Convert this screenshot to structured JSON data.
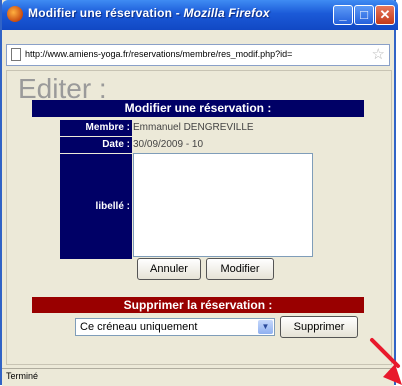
{
  "window": {
    "title_main": "Modifier une réservation - ",
    "title_app": "Mozilla Firefox",
    "min_glyph": "_",
    "max_glyph": "□",
    "close_glyph": "✕"
  },
  "address_bar": {
    "url": "http://www.amiens-yoga.fr/reservations/membre/res_modif.php?id="
  },
  "page": {
    "heading": "Editer :",
    "form_title": "Modifier une réservation :",
    "membre_label": "Membre :",
    "membre_value": "Emmanuel DENGREVILLE",
    "date_label": "Date :",
    "date_value": "30/09/2009 - 10",
    "libelle_label": "libellé :",
    "libelle_value": "",
    "annuler_label": "Annuler",
    "modifier_label": "Modifier",
    "delete_title": "Supprimer la réservation :",
    "delete_option_selected": "Ce créneau uniquement",
    "supprimer_label": "Supprimer"
  },
  "status": {
    "text": "Terminé"
  },
  "colors": {
    "panel_navy": "#000066",
    "delete_red": "#990000",
    "arrow_red": "#e8192c"
  }
}
